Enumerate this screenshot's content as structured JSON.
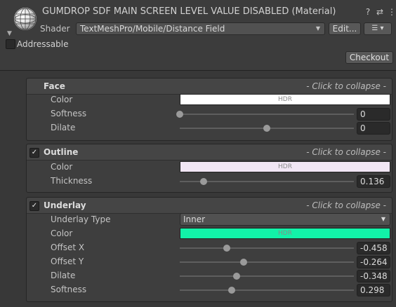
{
  "header": {
    "title": "GUMDROP SDF MAIN SCREEN LEVEL VALUE DISABLED (Material)",
    "help_icon": "?",
    "sliders_icon": "⇄",
    "kebab_icon": "⋮",
    "shader_label": "Shader",
    "shader_value": "TextMeshPro/Mobile/Distance Field",
    "edit_label": "Edit...",
    "shader_menu_icon": "☰ ▾",
    "addressable_label": "Addressable",
    "addressable_checked": false,
    "checkout_label": "Checkout"
  },
  "sections": {
    "face": {
      "title": "Face",
      "collapse": "- Click to collapse -",
      "color_label": "Color",
      "color_hdr": "HDR",
      "color_value": "#ffffff",
      "softness_label": "Softness",
      "softness_value": "0",
      "softness_level": 0.0,
      "dilate_label": "Dilate",
      "dilate_value": "0",
      "dilate_level": 0.5
    },
    "outline": {
      "title": "Outline",
      "enabled": true,
      "check": "✓",
      "collapse": "- Click to collapse -",
      "color_label": "Color",
      "color_hdr": "HDR",
      "color_value": "#f1e6f4",
      "thickness_label": "Thickness",
      "thickness_value": "0.136",
      "thickness_level": 0.136
    },
    "underlay": {
      "title": "Underlay",
      "enabled": true,
      "check": "✓",
      "collapse": "- Click to collapse -",
      "type_label": "Underlay Type",
      "type_value": "Inner",
      "color_label": "Color",
      "color_hdr": "HDR",
      "color_value": "#12f2a8",
      "offset_x_label": "Offset X",
      "offset_x_value": "-0.458",
      "offset_x_level": 0.271,
      "offset_y_label": "Offset Y",
      "offset_y_value": "-0.264",
      "offset_y_level": 0.368,
      "dilate_label": "Dilate",
      "dilate_value": "-0.348",
      "dilate_level": 0.326,
      "softness_label": "Softness",
      "softness_value": "0.298",
      "softness_level": 0.298
    }
  }
}
